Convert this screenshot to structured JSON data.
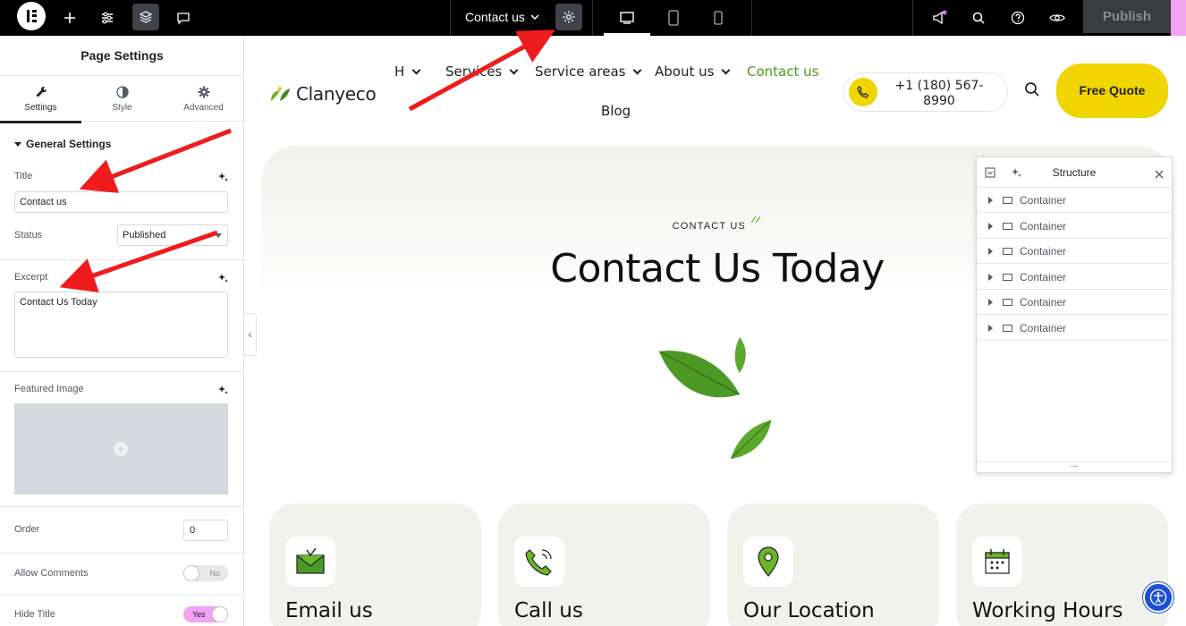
{
  "topbar": {
    "page_title": "Contact us",
    "publish_label": "Publish"
  },
  "panel": {
    "title": "Page Settings",
    "tabs": [
      {
        "label": "Settings"
      },
      {
        "label": "Style"
      },
      {
        "label": "Advanced"
      }
    ],
    "section_title": "General Settings",
    "title_label": "Title",
    "title_value": "Contact us",
    "status_label": "Status",
    "status_value": "Published",
    "excerpt_label": "Excerpt",
    "excerpt_value": "Contact Us Today",
    "featured_image_label": "Featured Image",
    "order_label": "Order",
    "order_value": "0",
    "allow_comments_label": "Allow Comments",
    "allow_comments_value": "No",
    "hide_title_label": "Hide Title",
    "hide_title_value": "Yes"
  },
  "site": {
    "logo_text": "Clanyeco",
    "nav": [
      {
        "label": "H"
      },
      {
        "label": "Services"
      },
      {
        "label": "Service areas"
      },
      {
        "label": "About us"
      },
      {
        "label": "Contact us"
      },
      {
        "label": "Blog"
      }
    ],
    "phone": "+1 (180) 567-8990",
    "quote_label": "Free Quote",
    "hero_kicker": "CONTACT US",
    "hero_title": "Contact Us Today",
    "cards": [
      {
        "title": "Email us"
      },
      {
        "title": "Call us"
      },
      {
        "title": "Our Location"
      },
      {
        "title": "Working Hours"
      }
    ]
  },
  "structure": {
    "title": "Structure",
    "items": [
      "Container",
      "Container",
      "Container",
      "Container",
      "Container",
      "Container"
    ],
    "footer": "..."
  },
  "colors": {
    "accent_green": "#4d9a1f",
    "accent_yellow": "#f0d500",
    "annotation_red": "#ee1c1c",
    "publish_pink": "#f1a3f4"
  }
}
